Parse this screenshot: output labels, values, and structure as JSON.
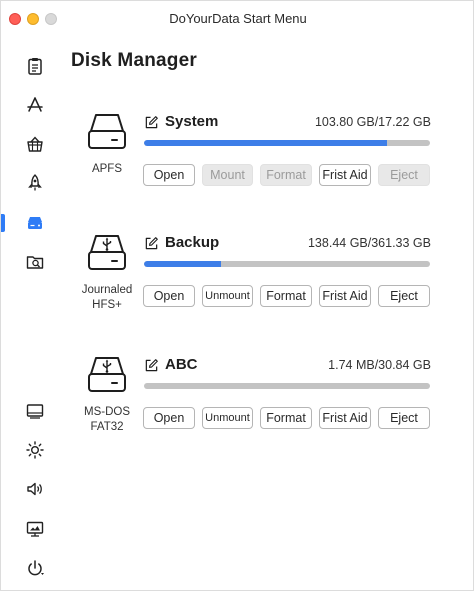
{
  "window": {
    "title": "DoYourData Start Menu"
  },
  "page": {
    "title": "Disk Manager"
  },
  "sidebar": {
    "items": [
      {
        "icon": "clipboard-icon",
        "active": false
      },
      {
        "icon": "app-store-icon",
        "active": false
      },
      {
        "icon": "basket-icon",
        "active": false
      },
      {
        "icon": "rocket-icon",
        "active": false
      },
      {
        "icon": "disk-drive-icon",
        "active": true
      },
      {
        "icon": "folder-search-icon",
        "active": false
      },
      {
        "icon": "display-icon",
        "active": false
      },
      {
        "icon": "brightness-icon",
        "active": false
      },
      {
        "icon": "volume-icon",
        "active": false
      },
      {
        "icon": "screen-capture-icon",
        "active": false
      },
      {
        "icon": "power-icon",
        "active": false
      }
    ]
  },
  "disks": [
    {
      "name": "System",
      "size": "103.80 GB/17.22 GB",
      "filesystem": [
        "APFS"
      ],
      "usage": 0.85,
      "type": "internal",
      "buttons": [
        {
          "label": "Open",
          "enabled": true
        },
        {
          "label": "Mount",
          "enabled": false
        },
        {
          "label": "Format",
          "enabled": false
        },
        {
          "label": "Frist Aid",
          "enabled": true
        },
        {
          "label": "Eject",
          "enabled": false
        }
      ]
    },
    {
      "name": "Backup",
      "size": "138.44 GB/361.33 GB",
      "filesystem": [
        "Journaled",
        "HFS+"
      ],
      "usage": 0.27,
      "type": "usb",
      "buttons": [
        {
          "label": "Open",
          "enabled": true
        },
        {
          "label": "Unmount",
          "enabled": true
        },
        {
          "label": "Format",
          "enabled": true
        },
        {
          "label": "Frist Aid",
          "enabled": true
        },
        {
          "label": "Eject",
          "enabled": true
        }
      ]
    },
    {
      "name": "ABC",
      "size": "1.74 MB/30.84 GB",
      "filesystem": [
        "MS-DOS",
        "FAT32"
      ],
      "usage": 0.0,
      "type": "usb",
      "buttons": [
        {
          "label": "Open",
          "enabled": true
        },
        {
          "label": "Unmount",
          "enabled": true
        },
        {
          "label": "Format",
          "enabled": true
        },
        {
          "label": "Frist Aid",
          "enabled": true
        },
        {
          "label": "Eject",
          "enabled": true
        }
      ]
    }
  ],
  "colors": {
    "accent": "#2f7cf6",
    "progress_fill": "#3d7ee8",
    "progress_track": "#c3c3c3",
    "disabled_button": "#e8e8e8"
  }
}
